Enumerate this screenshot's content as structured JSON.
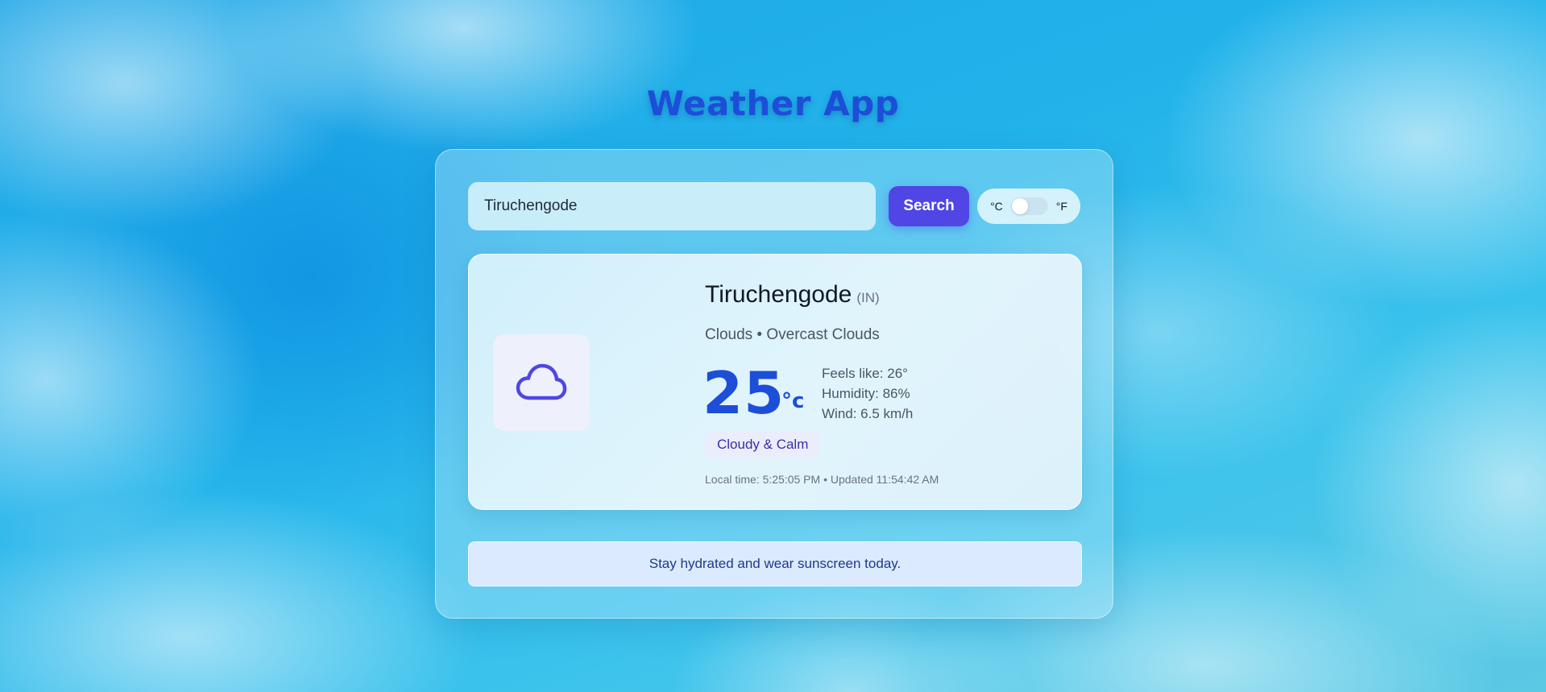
{
  "app": {
    "title": "Weather App"
  },
  "search": {
    "value": "Tiruchengode",
    "placeholder": "",
    "button_label": "Search"
  },
  "unit_toggle": {
    "celsius_label": "°C",
    "fahrenheit_label": "°F",
    "selected": "°C"
  },
  "weather": {
    "city": "Tiruchengode",
    "country": "(IN)",
    "condition": "Clouds • Overcast Clouds",
    "icon": "cloud-icon",
    "temperature": "25",
    "temperature_unit": "°c",
    "feels_like": "Feels like: 26°",
    "humidity": "Humidity: 86%",
    "wind": "Wind: 6.5 km/h",
    "mood": "Cloudy & Calm",
    "meta": "Local time: 5:25:05 PM • Updated 11:54:42 AM"
  },
  "tip": {
    "text": "Stay hydrated and wear sunscreen today."
  },
  "colors": {
    "accent": "#4f46e5",
    "title": "#1d4ed8",
    "temperature": "#1d4ed8",
    "tip_background": "#dbeafe",
    "tip_text": "#1e3a8a"
  }
}
